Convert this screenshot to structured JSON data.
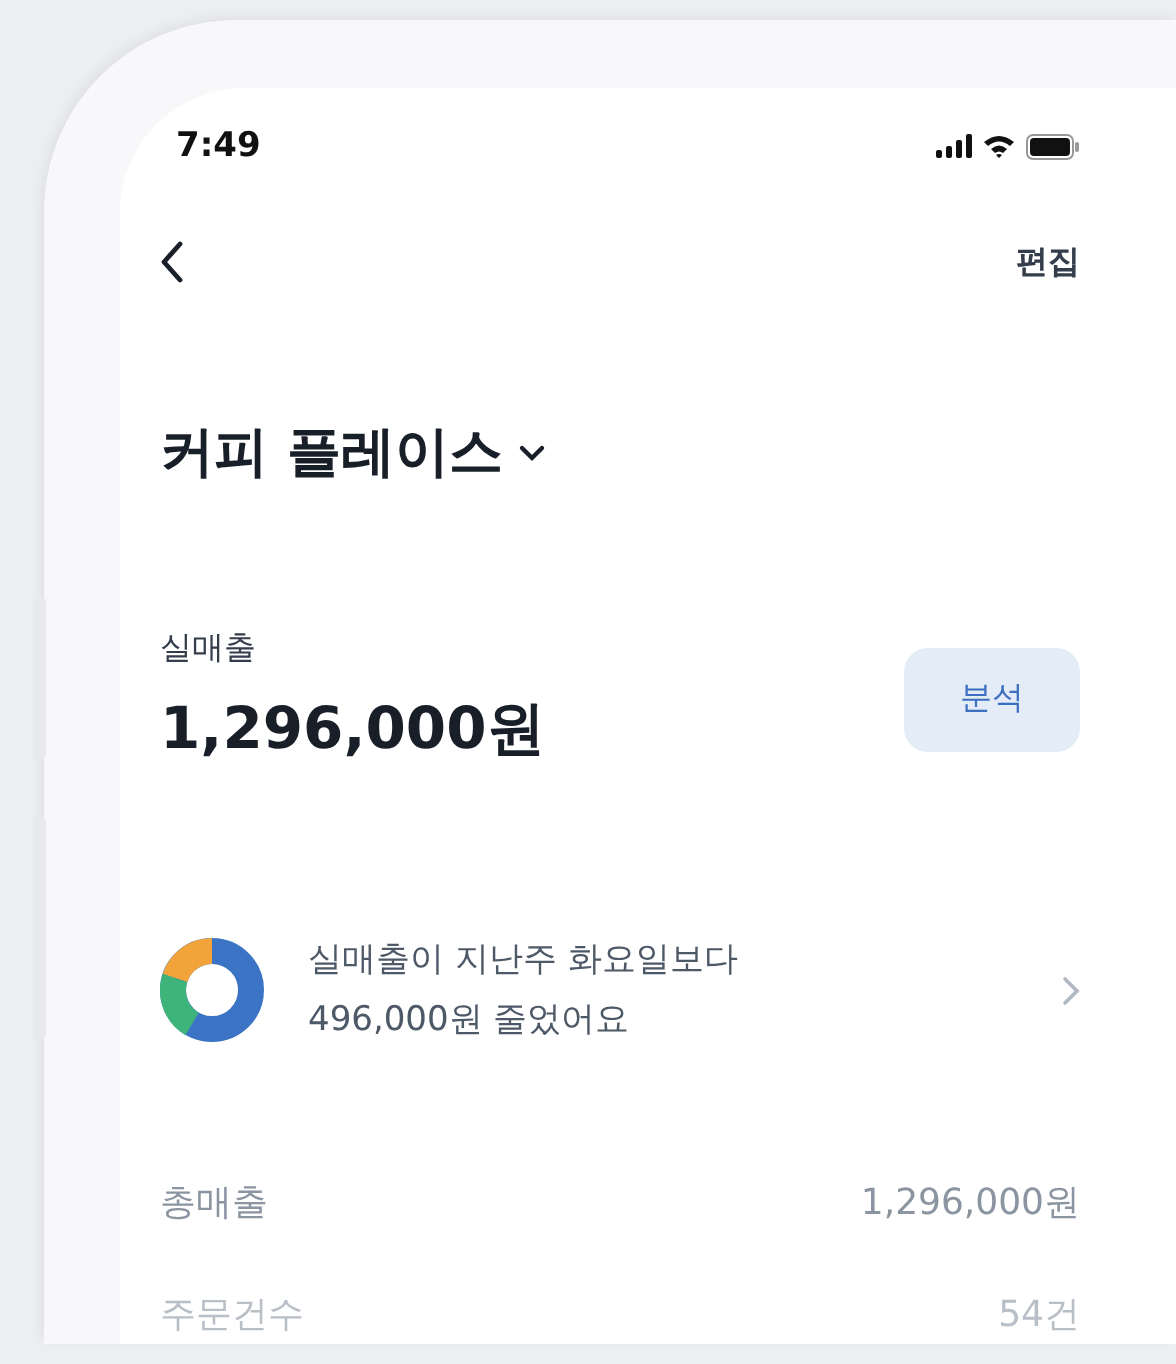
{
  "status_bar": {
    "time": "7:49"
  },
  "nav": {
    "action": "편집"
  },
  "store": {
    "name": "커피 플레이스"
  },
  "net_sales": {
    "label": "실매출",
    "amount": "1,296,000원",
    "button": "분석"
  },
  "insight": {
    "lines": [
      "실매출이 지난주 화요일보다",
      "496,000원 줄었어요"
    ]
  },
  "summary_rows": [
    {
      "label": "총매출",
      "value": "1,296,000원",
      "faded": false
    },
    {
      "label": "주문건수",
      "value": "54건",
      "faded": true
    }
  ]
}
